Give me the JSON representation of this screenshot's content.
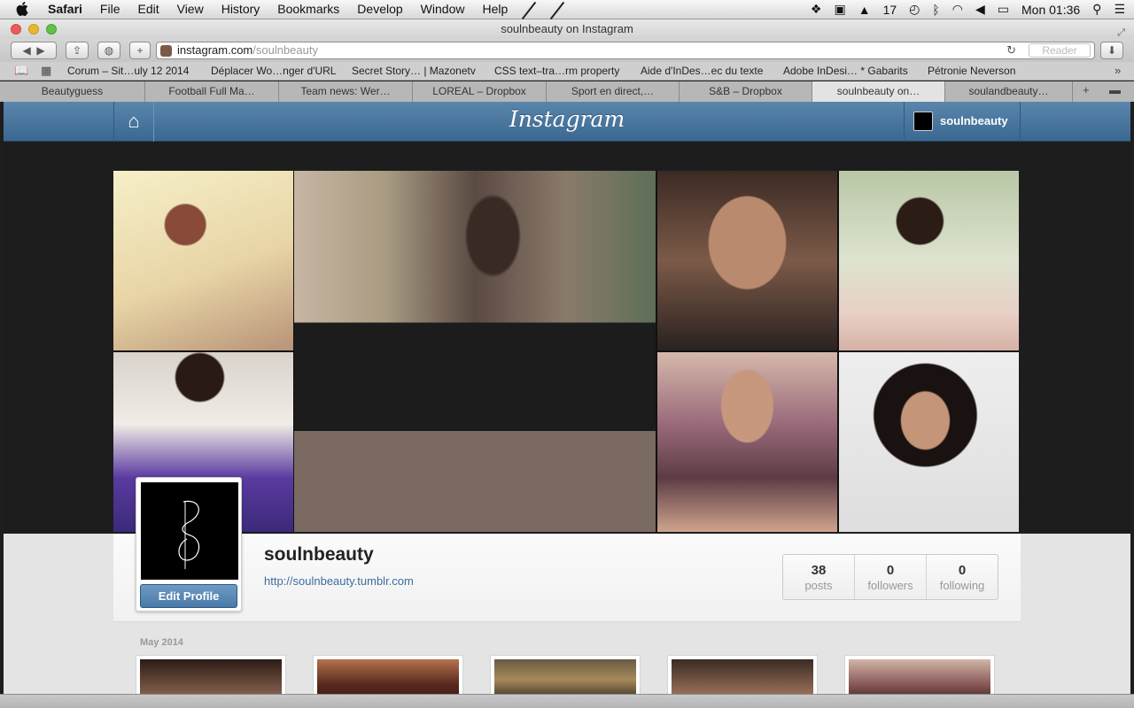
{
  "menubar": {
    "apple": "",
    "menus": [
      "Safari",
      "File",
      "Edit",
      "View",
      "History",
      "Bookmarks",
      "Develop",
      "Window",
      "Help"
    ],
    "status": {
      "badge": "17",
      "clock": "Mon 01:36"
    }
  },
  "window": {
    "title": "soulnbeauty on Instagram"
  },
  "toolbar": {
    "url_host": "instagram.com",
    "url_path": "/soulnbeauty",
    "reader_label": "Reader"
  },
  "bookmarks": [
    "Corum – Sit…uly 12 2014",
    "Déplacer Wo…nger d'URL",
    "Secret Story… | Mazonetv",
    "CSS text–tra…rm property",
    "Aide d'InDes…ec du texte",
    "Adobe InDesi… * Gabarits",
    "Pétronie Neverson"
  ],
  "tabs": [
    {
      "label": "Beautyguess",
      "active": false
    },
    {
      "label": "Football Full Ma…",
      "active": false
    },
    {
      "label": "Team news: Wer…",
      "active": false
    },
    {
      "label": "LOREAL – Dropbox",
      "active": false
    },
    {
      "label": "Sport en direct,…",
      "active": false
    },
    {
      "label": "S&B – Dropbox",
      "active": false
    },
    {
      "label": "soulnbeauty on…",
      "active": true
    },
    {
      "label": "soulandbeauty…",
      "active": false
    }
  ],
  "instagram": {
    "logo": "Instagram",
    "header_username": "soulnbeauty",
    "profile": {
      "username": "soulnbeauty",
      "website": "http://soulnbeauty.tumblr.com",
      "edit_label": "Edit Profile",
      "stats": [
        {
          "value": "38",
          "label": "posts"
        },
        {
          "value": "0",
          "label": "followers"
        },
        {
          "value": "0",
          "label": "following"
        }
      ]
    },
    "section_label": "May 2014"
  },
  "colors": {
    "ig_header_top": "#5a86ad",
    "ig_header_bottom": "#3b6890",
    "link": "#3b6d9c",
    "edit_button": "#4a7aa8"
  }
}
